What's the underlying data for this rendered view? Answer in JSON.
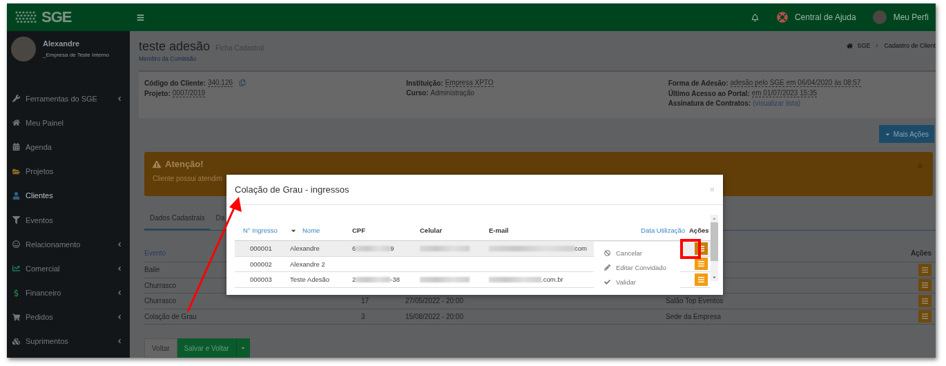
{
  "topbar": {
    "logo": "SGE",
    "help": "Central de Ajuda",
    "profile": "Meu Perfi"
  },
  "sidebar": {
    "user": {
      "name": "Alexandre",
      "company": "_Empresa de Teste Interno"
    },
    "items": [
      {
        "label": "Ferramentas do SGE",
        "selected": false,
        "submenu": true
      },
      {
        "label": "Meu Painel",
        "selected": false,
        "submenu": false
      },
      {
        "label": "Agenda",
        "selected": false,
        "submenu": false
      },
      {
        "label": "Projetos",
        "selected": false,
        "submenu": false
      },
      {
        "label": "Clientes",
        "selected": true,
        "submenu": false
      },
      {
        "label": "Eventos",
        "selected": false,
        "submenu": false
      },
      {
        "label": "Relacionamento",
        "selected": false,
        "submenu": true
      },
      {
        "label": "Comercial",
        "selected": false,
        "submenu": true
      },
      {
        "label": "Financeiro",
        "selected": false,
        "submenu": true
      },
      {
        "label": "Pedidos",
        "selected": false,
        "submenu": true
      },
      {
        "label": "Suprimentos",
        "selected": false,
        "submenu": true
      }
    ]
  },
  "header": {
    "title": "teste adesão",
    "subtitle": "Ficha Cadastral",
    "role": "Membro da Comissão",
    "breadcrumb": [
      "SGE",
      "Cadastro de Client"
    ]
  },
  "info": [
    [
      {
        "label": "Código do Cliente:",
        "value": "340.126",
        "kind": "dashed",
        "copy": true
      },
      {
        "label": "Projeto:",
        "value": "0007/2019",
        "kind": "dashed",
        "copy": false
      }
    ],
    [
      {
        "label": "Instituição:",
        "value": "Empresa XPTO",
        "kind": "dashed",
        "copy": false
      },
      {
        "label": "Curso:",
        "value": "Administração",
        "kind": "text",
        "copy": false
      }
    ],
    [
      {
        "label": "Forma de Adesão:",
        "value": "adesão pelo SGE em 06/04/2020 às 08:57",
        "kind": "dashed",
        "copy": false
      },
      {
        "label": "Último Acesso ao Portal:",
        "value": "em 01/07/2023 15:35",
        "kind": "dashed",
        "copy": false
      },
      {
        "label": "Assinatura de Contratos:",
        "value": "(visualizar lista)",
        "kind": "link",
        "copy": false
      }
    ]
  ],
  "more_actions": "Mais Ações",
  "alert": {
    "title": "Atenção!",
    "text": "Cliente possui atendim"
  },
  "tabs": [
    {
      "label": "Dados Cadastrais",
      "selected": true
    },
    {
      "label": "Da",
      "selected": false
    }
  ],
  "events": {
    "columns": {
      "event": "Evento",
      "actions": "Ações"
    },
    "rows": [
      {
        "event": "Baile"
      },
      {
        "event": "Churrasco"
      },
      {
        "event": "Churrasco",
        "column_2": "17",
        "column_3": "27/05/2022 - 20:00",
        "column_4": "Salão Top Eventos"
      },
      {
        "event": "Colação de Grau",
        "column_2": "3",
        "column_3": "15/08/2022 - 20:00",
        "column_4": "Sede da Empresa"
      }
    ]
  },
  "footer_buttons": {
    "back": "Voltar",
    "save": "Salvar e Voltar"
  },
  "modal": {
    "title": "Colação de Grau - ingressos",
    "close": "×",
    "columns": [
      "N° Ingresso",
      "Nome",
      "CPF",
      "Celular",
      "E-mail",
      "Data Utilização",
      "Ações"
    ],
    "rows": [
      {
        "number": "000001",
        "name": "Alexandre",
        "cpf_start": "6",
        "cpf_end": "9",
        "phone_blurred": true,
        "email_end": "com",
        "highlighted": true,
        "menu_open": true
      },
      {
        "number": "000002",
        "name": "Alexandre 2",
        "phone_blurred": false,
        "highlighted": false,
        "menu_open": false
      },
      {
        "number": "000003",
        "name": "Teste Adesão",
        "cpf_start": "2",
        "cpf_end": "-38",
        "phone_blurred": true,
        "email_end": ".com.br",
        "highlighted": false,
        "menu_open": false
      }
    ],
    "menu": [
      {
        "label": "Cancelar",
        "kind": "cancel"
      },
      {
        "label": "Editar Convidado",
        "kind": "edit"
      },
      {
        "label": "Validar",
        "kind": "validate"
      }
    ]
  }
}
